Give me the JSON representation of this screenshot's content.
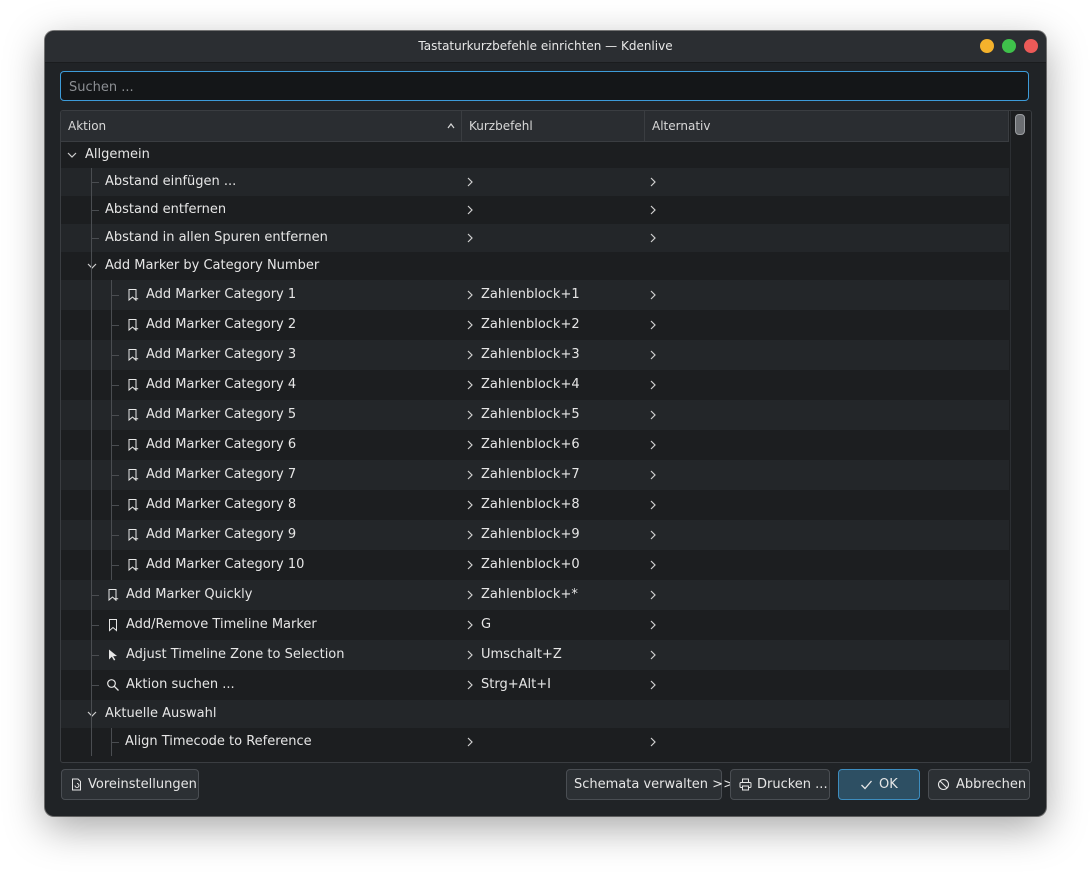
{
  "window": {
    "title": "Tastaturkurzbefehle einrichten — Kdenlive"
  },
  "search": {
    "placeholder": "Suchen ...",
    "value": ""
  },
  "columns": {
    "action": "Aktion",
    "shortcut": "Kurzbefehl",
    "alternative": "Alternativ"
  },
  "rows": [
    {
      "label": "Allgemein",
      "shortcut": "",
      "type": "group",
      "level": 0,
      "icon": "none"
    },
    {
      "label": "Abstand einfügen ...",
      "shortcut": "",
      "type": "item",
      "level": 1,
      "icon": "none"
    },
    {
      "label": "Abstand entfernen",
      "shortcut": "",
      "type": "item",
      "level": 1,
      "icon": "none"
    },
    {
      "label": "Abstand in allen Spuren entfernen",
      "shortcut": "",
      "type": "item",
      "level": 1,
      "icon": "none"
    },
    {
      "label": "Add Marker by Category Number",
      "shortcut": "",
      "type": "group",
      "level": 1,
      "icon": "none"
    },
    {
      "label": "Add Marker Category 1",
      "shortcut": "Zahlenblock+1",
      "type": "item",
      "level": 2,
      "icon": "bookmark-add-icon"
    },
    {
      "label": "Add Marker Category 2",
      "shortcut": "Zahlenblock+2",
      "type": "item",
      "level": 2,
      "icon": "bookmark-add-icon"
    },
    {
      "label": "Add Marker Category 3",
      "shortcut": "Zahlenblock+3",
      "type": "item",
      "level": 2,
      "icon": "bookmark-add-icon"
    },
    {
      "label": "Add Marker Category 4",
      "shortcut": "Zahlenblock+4",
      "type": "item",
      "level": 2,
      "icon": "bookmark-add-icon"
    },
    {
      "label": "Add Marker Category 5",
      "shortcut": "Zahlenblock+5",
      "type": "item",
      "level": 2,
      "icon": "bookmark-add-icon"
    },
    {
      "label": "Add Marker Category 6",
      "shortcut": "Zahlenblock+6",
      "type": "item",
      "level": 2,
      "icon": "bookmark-add-icon"
    },
    {
      "label": "Add Marker Category 7",
      "shortcut": "Zahlenblock+7",
      "type": "item",
      "level": 2,
      "icon": "bookmark-add-icon"
    },
    {
      "label": "Add Marker Category 8",
      "shortcut": "Zahlenblock+8",
      "type": "item",
      "level": 2,
      "icon": "bookmark-add-icon"
    },
    {
      "label": "Add Marker Category 9",
      "shortcut": "Zahlenblock+9",
      "type": "item",
      "level": 2,
      "icon": "bookmark-add-icon"
    },
    {
      "label": "Add Marker Category 10",
      "shortcut": "Zahlenblock+0",
      "type": "item",
      "level": 2,
      "icon": "bookmark-add-icon"
    },
    {
      "label": "Add Marker Quickly",
      "shortcut": "Zahlenblock+*",
      "type": "item",
      "level": 1,
      "icon": "bookmark-add-icon"
    },
    {
      "label": "Add/Remove Timeline Marker",
      "shortcut": "G",
      "type": "item",
      "level": 1,
      "icon": "bookmark-icon"
    },
    {
      "label": "Adjust Timeline Zone to Selection",
      "shortcut": "Umschalt+Z",
      "type": "item",
      "level": 1,
      "icon": "cursor-arrow-icon"
    },
    {
      "label": "Aktion suchen ...",
      "shortcut": "Strg+Alt+I",
      "type": "item",
      "level": 1,
      "icon": "search-icon"
    },
    {
      "label": "Aktuelle Auswahl",
      "shortcut": "",
      "type": "group",
      "level": 1,
      "icon": "none"
    },
    {
      "label": "Align Timecode to Reference",
      "shortcut": "",
      "type": "item",
      "level": 2,
      "icon": "none"
    }
  ],
  "buttons": {
    "defaults": "Voreinstellungen",
    "manage_schemes": "Schemata verwalten >>",
    "print": "Drucken ...",
    "ok": "OK",
    "cancel": "Abbrechen"
  },
  "colors": {
    "accent": "#3d9bd8",
    "window_bg": "#202326",
    "row_alt": "#232629"
  }
}
